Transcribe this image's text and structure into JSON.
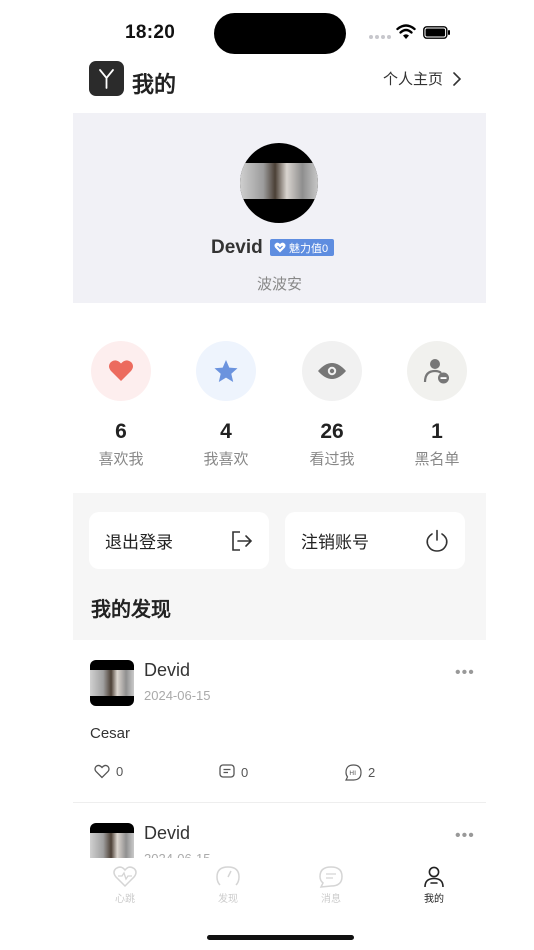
{
  "status_bar": {
    "time": "18:20"
  },
  "header": {
    "title": "我的",
    "profile_link": "个人主页"
  },
  "profile": {
    "name": "Devid",
    "charm_badge": "魅力值0",
    "subtitle": "波波安"
  },
  "stats": [
    {
      "count": "6",
      "label": "喜欢我",
      "icon": "heart-icon",
      "color": "#ec6b5e",
      "bg": "#fdeeee"
    },
    {
      "count": "4",
      "label": "我喜欢",
      "icon": "star-icon",
      "color": "#6b93de",
      "bg": "#eef4fd"
    },
    {
      "count": "26",
      "label": "看过我",
      "icon": "eye-icon",
      "color": "#777777",
      "bg": "#f1f1f1"
    },
    {
      "count": "1",
      "label": "黑名单",
      "icon": "user-block-icon",
      "color": "#777777",
      "bg": "#f1f1ee"
    }
  ],
  "actions": {
    "logout": "退出登录",
    "delete_account": "注销账号"
  },
  "section": {
    "title": "我的发现"
  },
  "posts": [
    {
      "name": "Devid",
      "date": "2024-06-15",
      "text": "Cesar",
      "likes": "0",
      "comments": "0",
      "greetings": "2"
    },
    {
      "name": "Devid",
      "date": "2024-06-15"
    }
  ],
  "tabs": [
    {
      "label": "心跳",
      "icon": "heartbeat-icon"
    },
    {
      "label": "发现",
      "icon": "compass-icon"
    },
    {
      "label": "消息",
      "icon": "message-icon"
    },
    {
      "label": "我的",
      "icon": "person-icon"
    }
  ],
  "colors": {
    "accent": "#5e8de0",
    "card_bg": "#f1f1f6"
  }
}
